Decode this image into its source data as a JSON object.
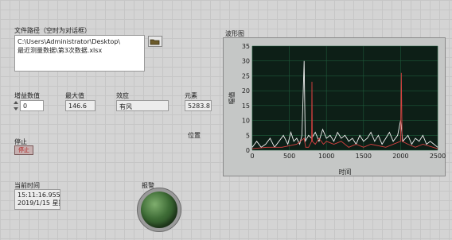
{
  "file_path": {
    "label": "文件路径（空时为对话框）",
    "value_lines": [
      "C:\\Users\\Administrator\\Desktop\\",
      "最近测量数据\\第3次数据.xlsx"
    ]
  },
  "number": {
    "label": "增益数值",
    "value": "0"
  },
  "max_value": {
    "label": "最大值",
    "value": "146.6"
  },
  "status": {
    "label": "效应",
    "value": "有风"
  },
  "element": {
    "label": "元素",
    "value": "5283.8"
  },
  "position_label": "位置",
  "stop": {
    "label": "停止",
    "button_label": "停止"
  },
  "current_time": {
    "label": "当前时间",
    "time": "15:11:16.955",
    "date": "2019/1/15 星期"
  },
  "indicator": {
    "label": "报警",
    "color": "#3d6b35"
  },
  "colors": {
    "plot_bg": "#0d1f17",
    "grid": "#1d5a3a",
    "white_series": "#f2f2f2",
    "red_series": "#d84040"
  },
  "chart_data": {
    "type": "line",
    "title": "波形图",
    "xlabel": "时间",
    "ylabel": "幅值",
    "xlim": [
      0,
      2500
    ],
    "ylim": [
      0,
      35
    ],
    "x_ticks": [
      0,
      500,
      1000,
      1500,
      2000,
      2500
    ],
    "y_ticks": [
      0,
      5,
      10,
      15,
      20,
      25,
      30,
      35
    ],
    "grid": true,
    "series": [
      {
        "color": "#f2f2f2",
        "points": [
          [
            0,
            1
          ],
          [
            60,
            3
          ],
          [
            120,
            1
          ],
          [
            180,
            2
          ],
          [
            240,
            4
          ],
          [
            300,
            1
          ],
          [
            360,
            3
          ],
          [
            420,
            5
          ],
          [
            480,
            2
          ],
          [
            520,
            6
          ],
          [
            560,
            3
          ],
          [
            600,
            4
          ],
          [
            640,
            2
          ],
          [
            670,
            5
          ],
          [
            700,
            30
          ],
          [
            715,
            3
          ],
          [
            760,
            5
          ],
          [
            800,
            4
          ],
          [
            850,
            6
          ],
          [
            900,
            3
          ],
          [
            950,
            7
          ],
          [
            1000,
            4
          ],
          [
            1050,
            5
          ],
          [
            1100,
            3
          ],
          [
            1150,
            6
          ],
          [
            1200,
            4
          ],
          [
            1250,
            5
          ],
          [
            1300,
            3
          ],
          [
            1350,
            4
          ],
          [
            1400,
            2
          ],
          [
            1450,
            5
          ],
          [
            1500,
            3
          ],
          [
            1550,
            4
          ],
          [
            1600,
            6
          ],
          [
            1650,
            3
          ],
          [
            1700,
            5
          ],
          [
            1750,
            2
          ],
          [
            1800,
            4
          ],
          [
            1850,
            6
          ],
          [
            1900,
            3
          ],
          [
            1960,
            5
          ],
          [
            2000,
            10
          ],
          [
            2030,
            3
          ],
          [
            2100,
            5
          ],
          [
            2150,
            2
          ],
          [
            2200,
            4
          ],
          [
            2250,
            3
          ],
          [
            2300,
            5
          ],
          [
            2350,
            2
          ],
          [
            2400,
            3
          ],
          [
            2450,
            2
          ],
          [
            2500,
            1
          ]
        ]
      },
      {
        "color": "#d84040",
        "points": [
          [
            0,
            0.5
          ],
          [
            200,
            1
          ],
          [
            400,
            1
          ],
          [
            600,
            2
          ],
          [
            700,
            4
          ],
          [
            720,
            1
          ],
          [
            760,
            1
          ],
          [
            800,
            3
          ],
          [
            805,
            23
          ],
          [
            810,
            3
          ],
          [
            850,
            2
          ],
          [
            900,
            4
          ],
          [
            960,
            2
          ],
          [
            1000,
            3
          ],
          [
            1100,
            2
          ],
          [
            1200,
            3
          ],
          [
            1300,
            1
          ],
          [
            1400,
            2
          ],
          [
            1500,
            1
          ],
          [
            1600,
            2
          ],
          [
            1800,
            1
          ],
          [
            2000,
            3
          ],
          [
            2010,
            26
          ],
          [
            2020,
            3
          ],
          [
            2100,
            2
          ],
          [
            2200,
            1
          ],
          [
            2300,
            2
          ],
          [
            2500,
            0.5
          ]
        ]
      }
    ]
  }
}
